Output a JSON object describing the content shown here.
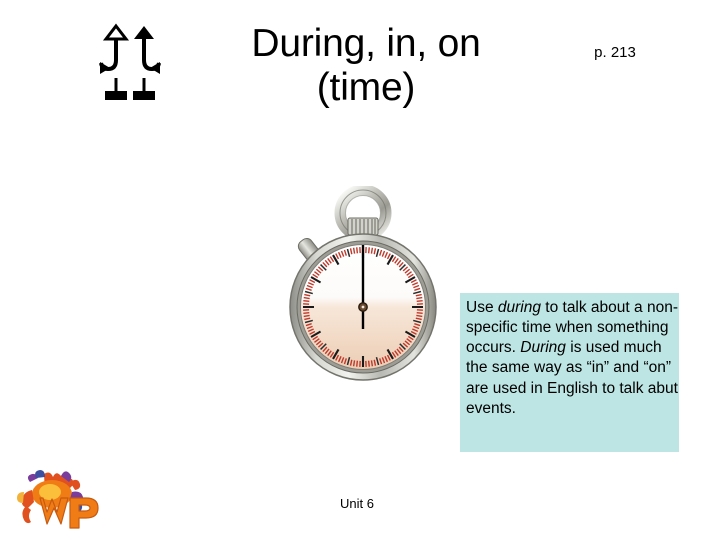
{
  "slide": {
    "title": "During, in, on\n(time)",
    "title_line1": "During, in, on",
    "title_line2": "(time)",
    "page_reference": "p. 213",
    "unit_label": "Unit 6",
    "background_color": "#ffffff"
  },
  "emblem": {
    "icon_name": "two-up-arrows-and-squares-emblem",
    "color": "#000000"
  },
  "illustration": {
    "icon_name": "stopwatch-illustration",
    "alt": "Stopwatch",
    "case_color": "#b9b9b3",
    "dial_color": "#f6e3d4",
    "tick_color": "#c0392b",
    "hand_color": "#000000"
  },
  "callout": {
    "background_color": "#bde5e3",
    "text_color": "#000000",
    "segments": [
      {
        "text": "Use ",
        "style": "normal"
      },
      {
        "text": "during",
        "style": "italic"
      },
      {
        "text": " to talk about a non-specific time when something occurs. ",
        "style": "normal"
      },
      {
        "text": "During",
        "style": "italic"
      },
      {
        "text": " is used much the same way as “in” and “on” are used in English to talk abut events.",
        "style": "normal"
      }
    ],
    "lines": [
      "Use during to talk about",
      "a non-specific time when",
      "something occurs.",
      "During is used much the",
      "same way as “in” and",
      "“on” are used in English",
      "to talk abut events."
    ]
  },
  "brand": {
    "icon_name": "wp-mascot-logo",
    "letters": "WP",
    "primary_color": "#f07c16",
    "secondary_color": "#7a3d9c"
  }
}
